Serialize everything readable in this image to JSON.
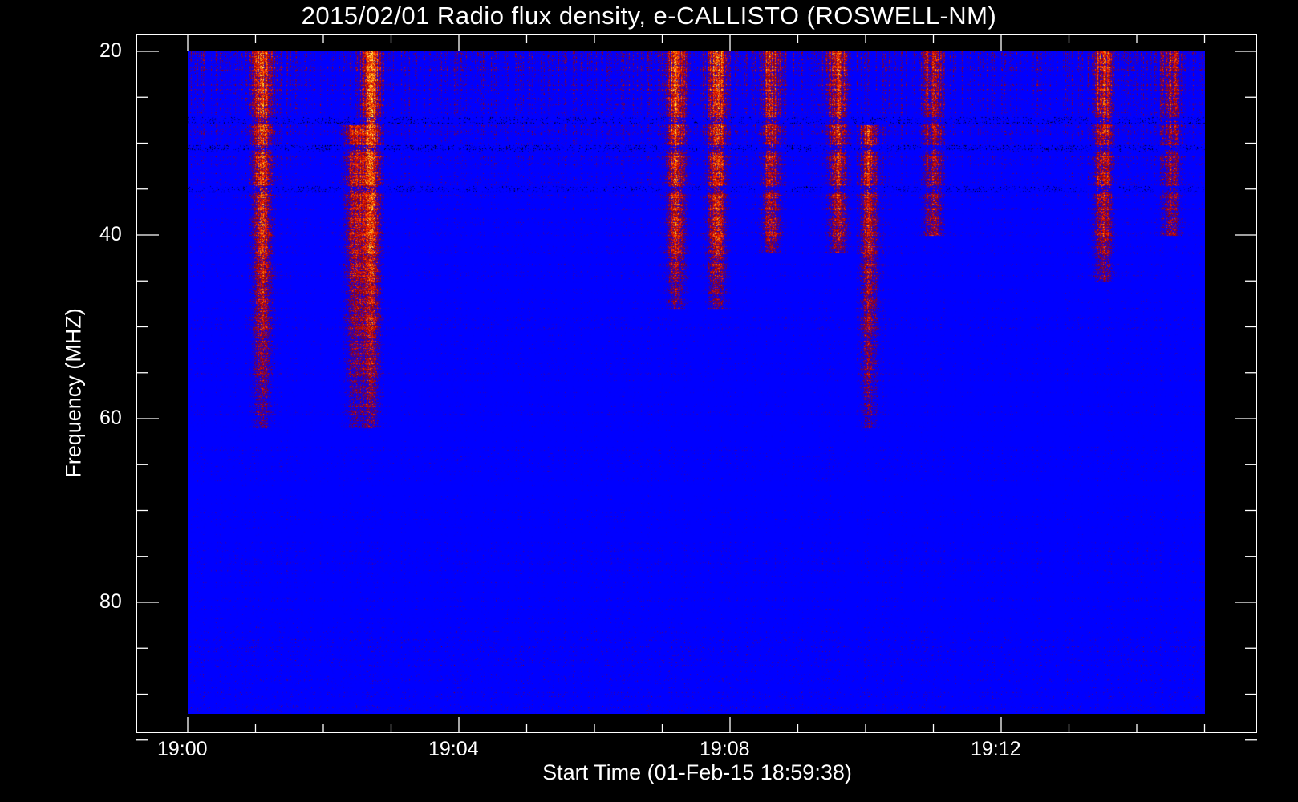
{
  "chart_data": {
    "type": "heatmap",
    "title": "2015/02/01  Radio flux density, e-CALLISTO (ROSWELL-NM)",
    "xlabel": "Start Time (01-Feb-15 18:59:38)",
    "ylabel": "Frequency (MHZ)",
    "x_ticks": [
      {
        "label": "19:00",
        "minutes": 0
      },
      {
        "label": "19:04",
        "minutes": 4
      },
      {
        "label": "19:08",
        "minutes": 8
      },
      {
        "label": "19:12",
        "minutes": 12
      }
    ],
    "y_ticks": [
      {
        "label": "20",
        "mhz": 20
      },
      {
        "label": "40",
        "mhz": 40
      },
      {
        "label": "60",
        "mhz": 60
      },
      {
        "label": "80",
        "mhz": 80
      }
    ],
    "x_minor_step_minutes": 1,
    "y_minor_step_mhz": 5,
    "xlim_minutes": [
      -0.75,
      16.3
    ],
    "ylim_mhz": [
      18.1,
      96.9
    ],
    "data_extent": {
      "minutes": [
        0,
        15
      ],
      "mhz": [
        20,
        92
      ]
    },
    "colormap": [
      "#000000",
      "#0000ff",
      "#8a0000",
      "#ff2000",
      "#ff9900",
      "#ffff60"
    ],
    "features": {
      "bright_band": {
        "mhz": 23,
        "minutes": [
          0,
          5
        ]
      },
      "dark_bands_mhz": [
        27.5,
        30.5,
        35
      ],
      "bursts": [
        {
          "minutes": 1.1,
          "mhz_top": 20,
          "mhz_bottom": 61,
          "intensity": 0.9
        },
        {
          "minutes": 2.7,
          "mhz_top": 20,
          "mhz_bottom": 61,
          "intensity": 0.95
        },
        {
          "minutes": 2.45,
          "mhz_top": 28,
          "mhz_bottom": 61,
          "intensity": 0.7
        },
        {
          "minutes": 7.2,
          "mhz_top": 20,
          "mhz_bottom": 48,
          "intensity": 0.85
        },
        {
          "minutes": 7.8,
          "mhz_top": 20,
          "mhz_bottom": 48,
          "intensity": 0.9
        },
        {
          "minutes": 8.6,
          "mhz_top": 20,
          "mhz_bottom": 42,
          "intensity": 0.75
        },
        {
          "minutes": 9.6,
          "mhz_top": 20,
          "mhz_bottom": 42,
          "intensity": 0.75
        },
        {
          "minutes": 10.05,
          "mhz_top": 28,
          "mhz_bottom": 61,
          "intensity": 0.8
        },
        {
          "minutes": 11.0,
          "mhz_top": 20,
          "mhz_bottom": 40,
          "intensity": 0.65
        },
        {
          "minutes": 13.5,
          "mhz_top": 20,
          "mhz_bottom": 45,
          "intensity": 0.75
        },
        {
          "minutes": 14.5,
          "mhz_top": 20,
          "mhz_bottom": 40,
          "intensity": 0.6
        }
      ]
    }
  }
}
